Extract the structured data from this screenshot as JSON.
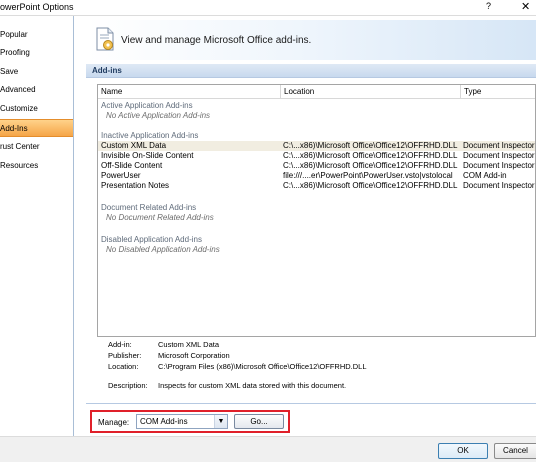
{
  "window": {
    "title": "owerPoint Options",
    "help": "?",
    "close": "✕"
  },
  "nav": {
    "items": [
      {
        "label": "Popular"
      },
      {
        "label": "Proofing"
      },
      {
        "label": "Save"
      },
      {
        "label": "Advanced"
      },
      {
        "label": "Customize"
      },
      {
        "label": "Add-Ins"
      },
      {
        "label": "rust Center"
      },
      {
        "label": "Resources"
      }
    ],
    "selected": "Add-Ins"
  },
  "banner": {
    "text": "View and manage Microsoft Office add-ins.",
    "icon": "gear-document-icon"
  },
  "section": {
    "title": "Add-ins"
  },
  "grid": {
    "columns": [
      "Name",
      "Location",
      "Type"
    ],
    "groups": {
      "active": "Active Application Add-ins",
      "active_empty": "No Active Application Add-ins",
      "inactive": "Inactive Application Add-ins",
      "document": "Document Related Add-ins",
      "document_empty": "No Document Related Add-ins",
      "disabled": "Disabled Application Add-ins",
      "disabled_empty": "No Disabled Application Add-ins"
    },
    "rows": [
      {
        "name": "Custom XML Data",
        "location": "C:\\...x86)\\Microsoft Office\\Office12\\OFFRHD.DLL",
        "type": "Document Inspector"
      },
      {
        "name": "Invisible On-Slide Content",
        "location": "C:\\...x86)\\Microsoft Office\\Office12\\OFFRHD.DLL",
        "type": "Document Inspector"
      },
      {
        "name": "Off-Slide Content",
        "location": "C:\\...x86)\\Microsoft Office\\Office12\\OFFRHD.DLL",
        "type": "Document Inspector"
      },
      {
        "name": "PowerUser",
        "location": "file:///....er\\PowerPoint\\PowerUser.vsto|vstolocal",
        "type": "COM Add-in"
      },
      {
        "name": "Presentation Notes",
        "location": "C:\\...x86)\\Microsoft Office\\Office12\\OFFRHD.DLL",
        "type": "Document Inspector"
      }
    ],
    "selected_row": "Custom XML Data"
  },
  "details": {
    "addin_label": "Add-in:",
    "addin_value": "Custom XML Data",
    "publisher_label": "Publisher:",
    "publisher_value": "Microsoft Corporation",
    "location_label": "Location:",
    "location_value": "C:\\Program Files (x86)\\Microsoft Office\\Office12\\OFFRHD.DLL",
    "description_label": "Description:",
    "description_value": "Inspects for custom XML data stored with this document."
  },
  "manage": {
    "label": "Manage:",
    "selected": "COM Add-ins",
    "go_label": "Go..."
  },
  "footer": {
    "ok_label": "OK",
    "cancel_label": "Cancel"
  },
  "colors": {
    "highlight": "#e0202a",
    "nav_selected": "#f5a548",
    "header_blue": "#1f3b60"
  }
}
